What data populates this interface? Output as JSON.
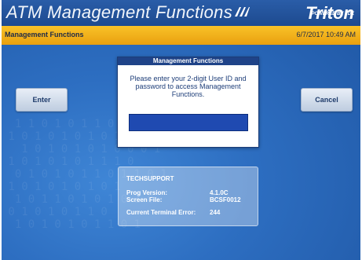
{
  "header": {
    "title": "ATM Management Functions",
    "brand": "Triton",
    "brand_tagline": "POWERED BY TDX"
  },
  "status_bar": {
    "screen_name": "Management Functions",
    "datetime": "6/7/2017  10:49 AM"
  },
  "buttons": {
    "enter": "Enter",
    "cancel": "Cancel"
  },
  "dialog": {
    "title": "Management Functions",
    "message": "Please enter your 2-digit User ID and password to access Management Functions.",
    "password_value": ""
  },
  "info": {
    "user": "TECHSUPPORT",
    "prog_version_label": "Prog Version:",
    "prog_version_value": "4.1.0C",
    "screen_file_label": "Screen File:",
    "screen_file_value": "BCSF0012",
    "terminal_error_label": "Current Terminal Error:",
    "terminal_error_value": "244"
  },
  "colors": {
    "background": "#2d6ec1",
    "title_bar": "#1d4a8f",
    "status_bar": "#f2b11c",
    "dialog_header": "#1f4388",
    "password_field": "#1f4ab1"
  }
}
